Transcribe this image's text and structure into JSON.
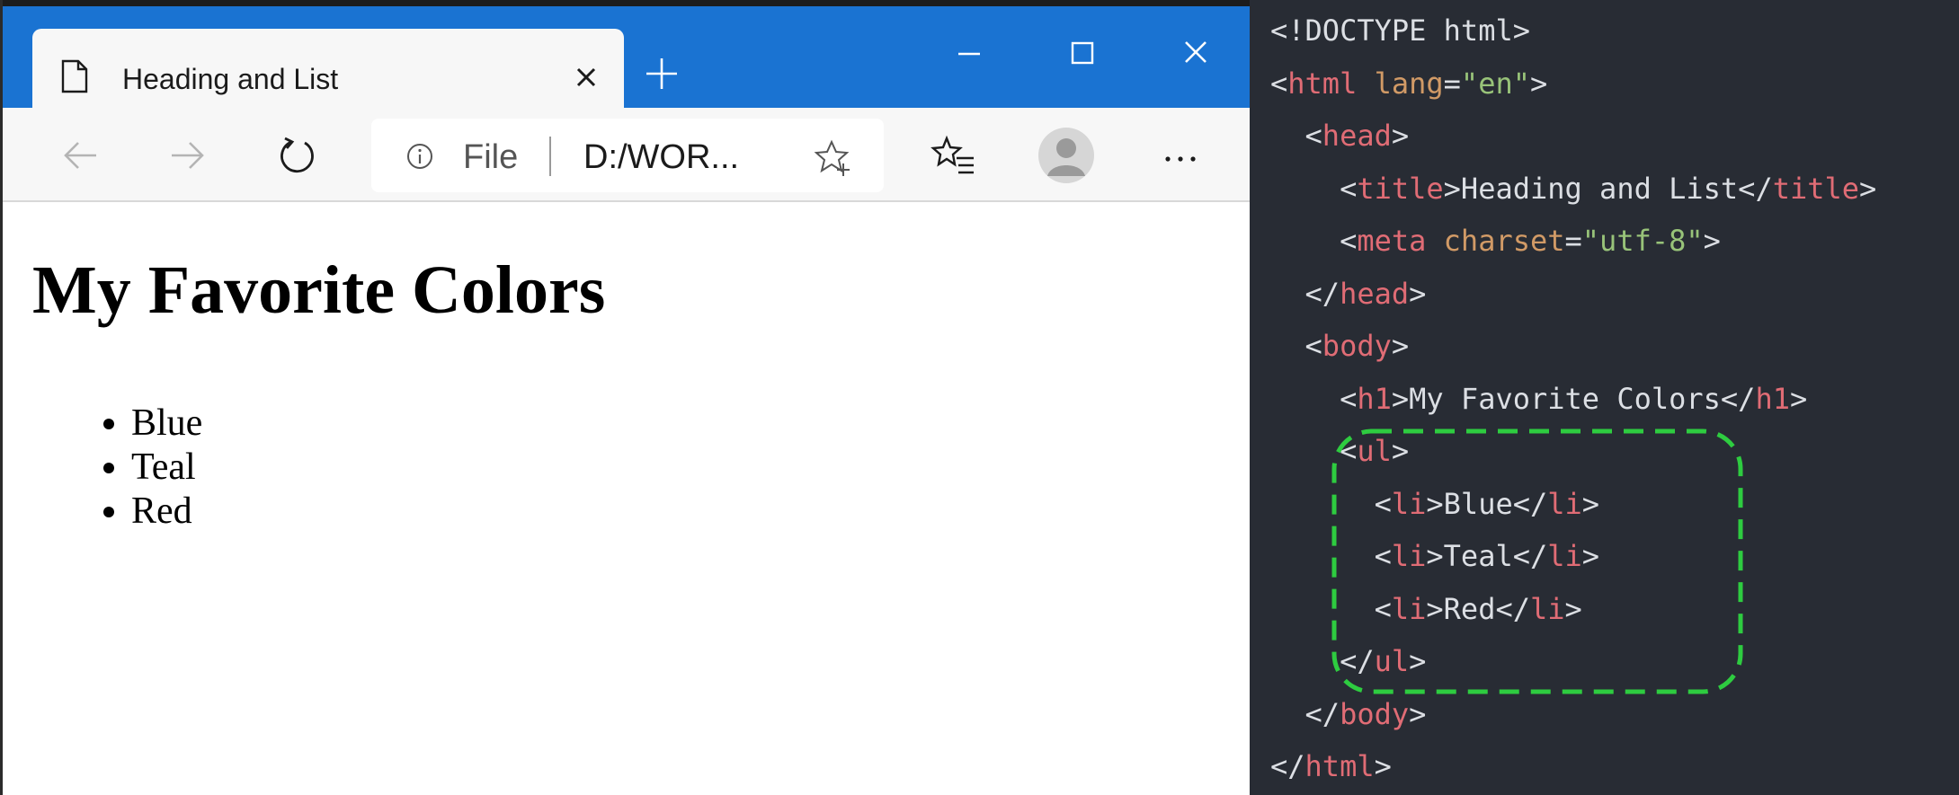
{
  "browser": {
    "tab": {
      "title": "Heading and List",
      "icon": "page-icon"
    },
    "address": {
      "scheme": "File",
      "url": "D:/WOR..."
    },
    "icons": [
      "back-arrow-icon",
      "forward-arrow-icon",
      "refresh-icon",
      "info-icon",
      "add-favorite-star-icon",
      "favorites-list-icon",
      "profile-avatar-icon",
      "more-dots-icon",
      "minimize-icon",
      "maximize-icon",
      "close-icon"
    ],
    "colors": {
      "titlebar": "#1a73d2",
      "toolbar": "#f7f7f7",
      "page": "#ffffff"
    }
  },
  "page": {
    "heading": "My Favorite Colors",
    "list": [
      "Blue",
      "Teal",
      "Red"
    ]
  },
  "code": {
    "colors": {
      "background": "#282c34",
      "punct": "#dcdfe4",
      "tag": "#e06c75",
      "attr": "#d19a66",
      "string": "#98c379",
      "highlight": "#2ecc40"
    },
    "lines": [
      [
        {
          "t": "punct",
          "v": "<!DOCTYPE html>"
        }
      ],
      [
        {
          "t": "punct",
          "v": "<"
        },
        {
          "t": "tag",
          "v": "html"
        },
        {
          "t": "punct",
          "v": " "
        },
        {
          "t": "attr",
          "v": "lang"
        },
        {
          "t": "punct",
          "v": "="
        },
        {
          "t": "str",
          "v": "\"en\""
        },
        {
          "t": "punct",
          "v": ">"
        }
      ],
      [
        {
          "t": "punct",
          "v": "  <"
        },
        {
          "t": "tag",
          "v": "head"
        },
        {
          "t": "punct",
          "v": ">"
        }
      ],
      [
        {
          "t": "punct",
          "v": "    <"
        },
        {
          "t": "tag",
          "v": "title"
        },
        {
          "t": "punct",
          "v": ">"
        },
        {
          "t": "text",
          "v": "Heading and List"
        },
        {
          "t": "punct",
          "v": "</"
        },
        {
          "t": "tag",
          "v": "title"
        },
        {
          "t": "punct",
          "v": ">"
        }
      ],
      [
        {
          "t": "punct",
          "v": "    <"
        },
        {
          "t": "tag",
          "v": "meta"
        },
        {
          "t": "punct",
          "v": " "
        },
        {
          "t": "attr",
          "v": "charset"
        },
        {
          "t": "punct",
          "v": "="
        },
        {
          "t": "str",
          "v": "\"utf-8\""
        },
        {
          "t": "punct",
          "v": ">"
        }
      ],
      [
        {
          "t": "punct",
          "v": "  </"
        },
        {
          "t": "tag",
          "v": "head"
        },
        {
          "t": "punct",
          "v": ">"
        }
      ],
      [
        {
          "t": "punct",
          "v": "  <"
        },
        {
          "t": "tag",
          "v": "body"
        },
        {
          "t": "punct",
          "v": ">"
        }
      ],
      [
        {
          "t": "punct",
          "v": "    <"
        },
        {
          "t": "tag",
          "v": "h1"
        },
        {
          "t": "punct",
          "v": ">"
        },
        {
          "t": "text",
          "v": "My Favorite Colors"
        },
        {
          "t": "punct",
          "v": "</"
        },
        {
          "t": "tag",
          "v": "h1"
        },
        {
          "t": "punct",
          "v": ">"
        }
      ],
      [
        {
          "t": "punct",
          "v": "    <"
        },
        {
          "t": "tag",
          "v": "ul"
        },
        {
          "t": "punct",
          "v": ">"
        }
      ],
      [
        {
          "t": "punct",
          "v": "      <"
        },
        {
          "t": "tag",
          "v": "li"
        },
        {
          "t": "punct",
          "v": ">"
        },
        {
          "t": "text",
          "v": "Blue"
        },
        {
          "t": "punct",
          "v": "</"
        },
        {
          "t": "tag",
          "v": "li"
        },
        {
          "t": "punct",
          "v": ">"
        }
      ],
      [
        {
          "t": "punct",
          "v": "      <"
        },
        {
          "t": "tag",
          "v": "li"
        },
        {
          "t": "punct",
          "v": ">"
        },
        {
          "t": "text",
          "v": "Teal"
        },
        {
          "t": "punct",
          "v": "</"
        },
        {
          "t": "tag",
          "v": "li"
        },
        {
          "t": "punct",
          "v": ">"
        }
      ],
      [
        {
          "t": "punct",
          "v": "      <"
        },
        {
          "t": "tag",
          "v": "li"
        },
        {
          "t": "punct",
          "v": ">"
        },
        {
          "t": "text",
          "v": "Red"
        },
        {
          "t": "punct",
          "v": "</"
        },
        {
          "t": "tag",
          "v": "li"
        },
        {
          "t": "punct",
          "v": ">"
        }
      ],
      [
        {
          "t": "punct",
          "v": "    </"
        },
        {
          "t": "tag",
          "v": "ul"
        },
        {
          "t": "punct",
          "v": ">"
        }
      ],
      [
        {
          "t": "punct",
          "v": "  </"
        },
        {
          "t": "tag",
          "v": "body"
        },
        {
          "t": "punct",
          "v": ">"
        }
      ],
      [
        {
          "t": "punct",
          "v": "</"
        },
        {
          "t": "tag",
          "v": "html"
        },
        {
          "t": "punct",
          "v": ">"
        }
      ]
    ]
  }
}
